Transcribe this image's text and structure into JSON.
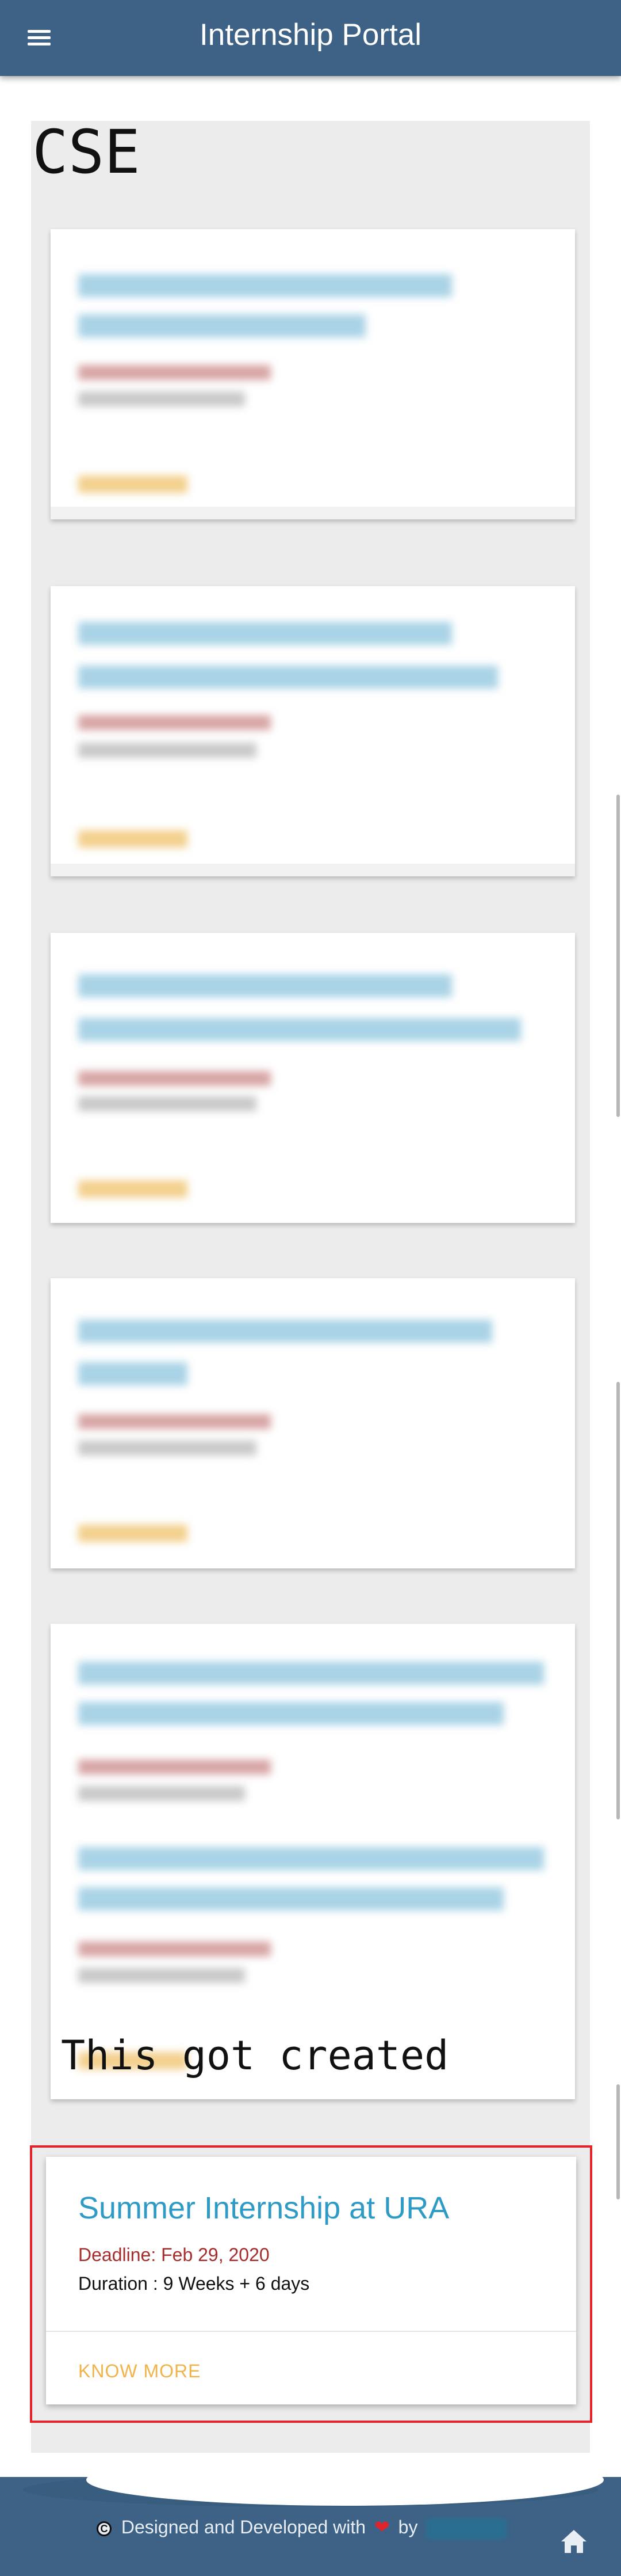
{
  "header": {
    "title": "Internship Portal",
    "menu_icon": "hamburger-menu-icon"
  },
  "section": {
    "title": "CSE"
  },
  "overlay": {
    "text": "This got created"
  },
  "featured_card": {
    "title": "Summer Internship at URA",
    "deadline": "Deadline: Feb 29, 2020",
    "duration": "Duration : 9 Weeks + 6 days",
    "action": "KNOW MORE"
  },
  "footer": {
    "text_prefix": "Designed and Developed with",
    "text_by": "by",
    "copyright_symbol": "C",
    "heart_icon": "heart-icon",
    "home_icon": "home-icon"
  },
  "colors": {
    "header_bg": "#3d6285",
    "accent_blue": "#2e9ac6",
    "deadline_red": "#a72c2c",
    "know_more": "#f0b44b",
    "highlight_border": "#e3242b"
  }
}
